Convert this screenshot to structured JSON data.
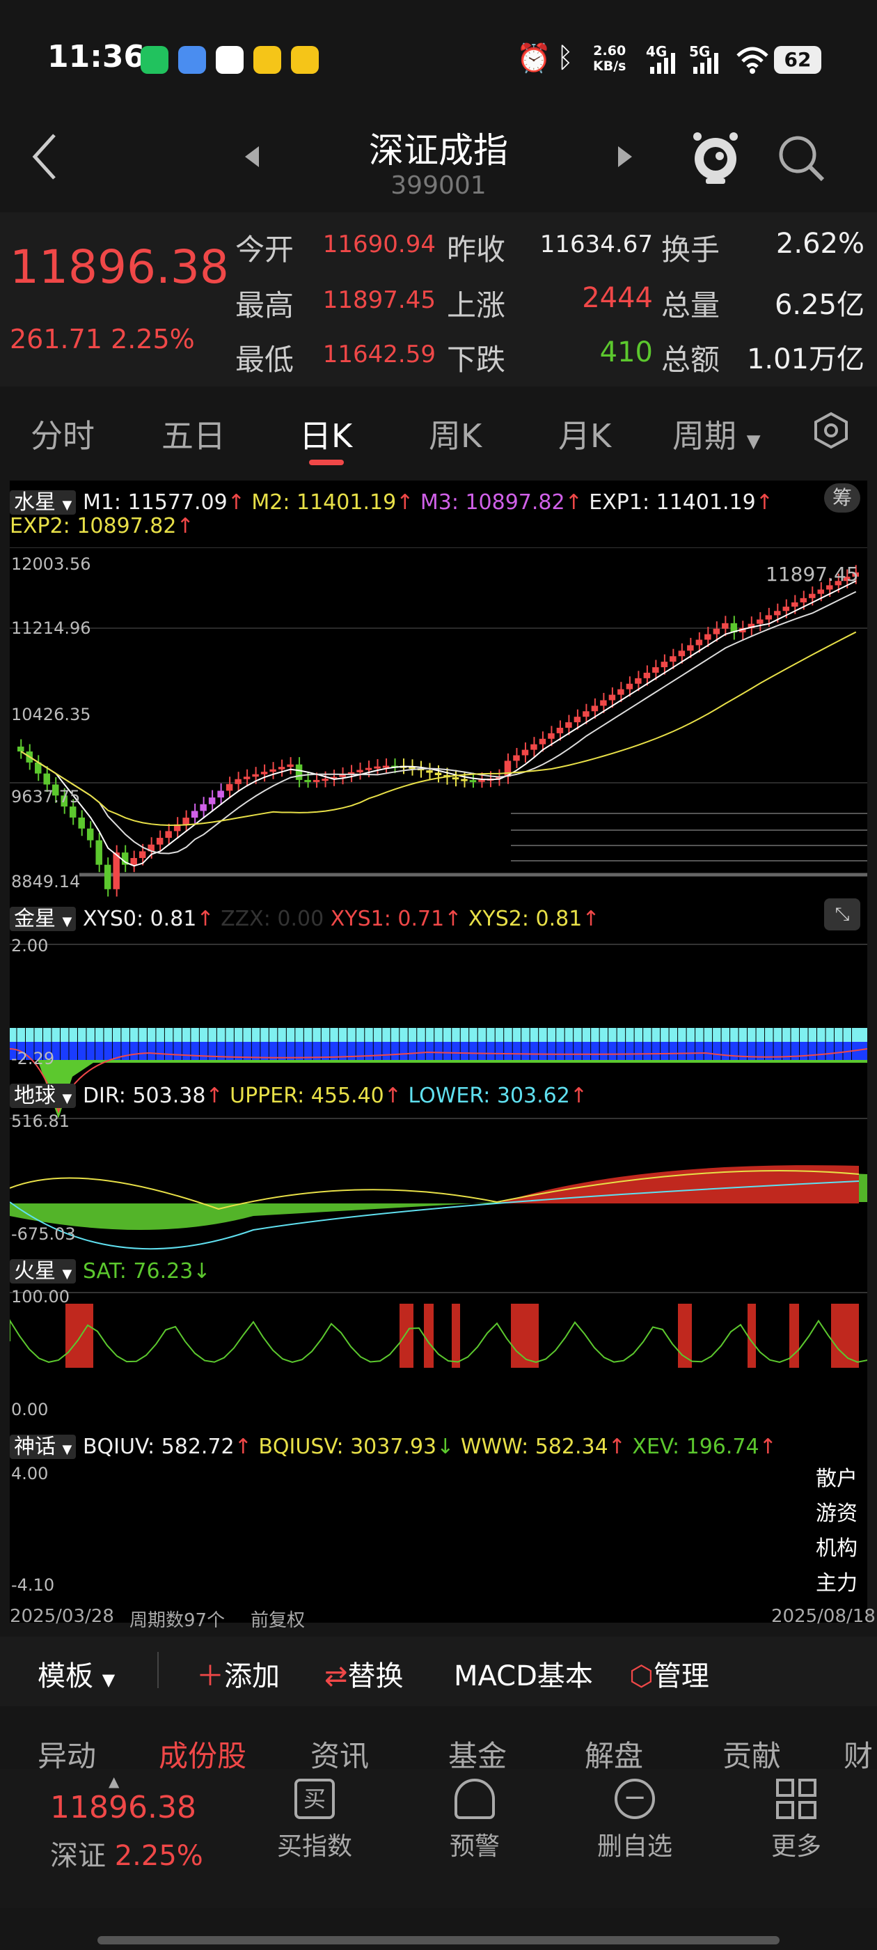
{
  "status": {
    "time": "11:36",
    "net_speed": "2.60",
    "net_unit": "KB/s",
    "signal1": "4G",
    "signal2": "5G",
    "battery": "62"
  },
  "header": {
    "title": "深证成指",
    "code": "399001"
  },
  "quote": {
    "price": "11896.38",
    "change": "261.71",
    "change_pct": "2.25%",
    "open_label": "今开",
    "open": "11690.94",
    "high_label": "最高",
    "high": "11897.45",
    "low_label": "最低",
    "low": "11642.59",
    "prev_close_label": "昨收",
    "prev_close": "11634.67",
    "up_label": "上涨",
    "up": "2444",
    "down_label": "下跌",
    "down": "410",
    "turnover_label": "换手",
    "turnover": "2.62%",
    "volume_label": "总量",
    "volume": "6.25亿",
    "amount_label": "总额",
    "amount": "1.01万亿"
  },
  "tabs": [
    "分时",
    "五日",
    "日K",
    "周K",
    "月K",
    "周期"
  ],
  "main_ind": {
    "name": "水星",
    "m1": "M1: 11577.09",
    "m2": "M2: 11401.19",
    "m3": "M3: 10897.82",
    "exp1": "EXP1: 11401.19",
    "exp2": "EXP2: 10897.82",
    "chip_btn": "筹",
    "y_top": "12003.56",
    "y2": "11214.96",
    "y3": "10426.35",
    "y4": "9637.75",
    "y_bot": "8849.14",
    "max_label": "11897.45"
  },
  "ind2": {
    "name": "金星",
    "xys0": "XYS0: 0.81",
    "zzx": "ZZX: 0.00",
    "xys1": "XYS1: 0.71",
    "xys2": "XYS2: 0.81",
    "y_top": "2.00",
    "y_bot": "-2.29"
  },
  "ind3": {
    "name": "地球",
    "dir": "DIR: 503.38",
    "upper": "UPPER: 455.40",
    "lower": "LOWER: 303.62",
    "y_top": "516.81",
    "y_bot": "-675.03"
  },
  "ind4": {
    "name": "火星",
    "sat": "SAT: 76.23",
    "y_top": "100.00",
    "y_bot": "0.00"
  },
  "ind5": {
    "name": "神话",
    "bqiuv": "BQIUV: 582.72",
    "bqiusv": "BQIUSV: 3037.93",
    "www": "WWW: 582.34",
    "xev": "XEV: 196.74",
    "y_top": "4.00",
    "y_bot": "-4.10",
    "rows": [
      "散户",
      "游资",
      "机构",
      "主力"
    ]
  },
  "footer_info": {
    "start_date": "2025/03/28",
    "periods": "周期数97个",
    "adjust": "前复权",
    "end_date": "2025/08/18"
  },
  "toolbar": {
    "template": "模板",
    "add": "添加",
    "replace": "替换",
    "macd": "MACD基本",
    "manage": "管理"
  },
  "subtabs": [
    "异动",
    "成份股",
    "资讯",
    "基金",
    "解盘",
    "贡献",
    "财"
  ],
  "bottom": {
    "price": "11896.38",
    "market": "深证",
    "pct": "2.25%",
    "buy": "买指数",
    "alert": "预警",
    "remove": "删自选",
    "more": "更多"
  }
}
